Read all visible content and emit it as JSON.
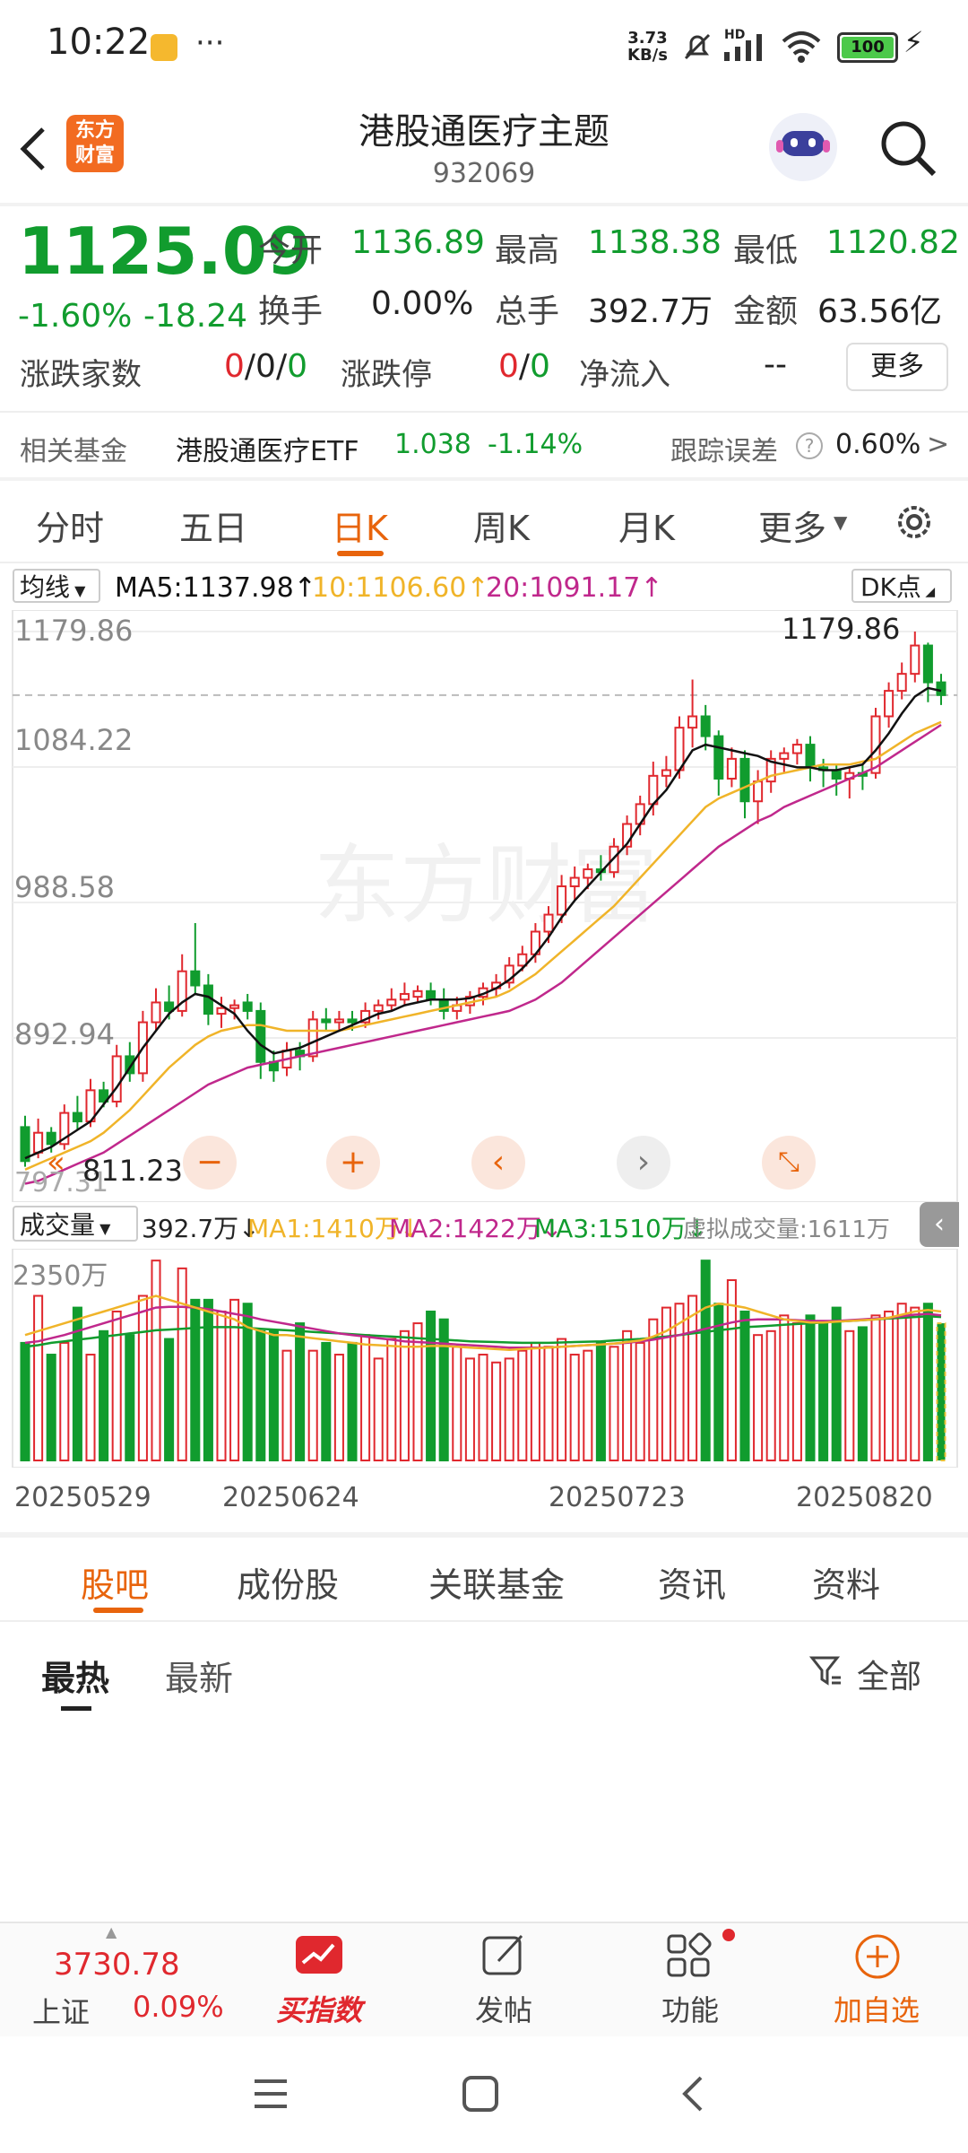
{
  "status_bar": {
    "time": "10:22",
    "more": "···",
    "net_speed_value": "3.73",
    "net_speed_unit": "KB/s",
    "hd": "HD",
    "battery": "100"
  },
  "header": {
    "brand_line1": "东方",
    "brand_line2": "财富",
    "title": "港股通医疗主题",
    "code": "932069"
  },
  "quote": {
    "price": "1125.09",
    "change_pct": "-1.60%",
    "change": "-18.24",
    "open_label": "今开",
    "open": "1136.89",
    "high_label": "最高",
    "high": "1138.38",
    "low_label": "最低",
    "low": "1120.82",
    "turnover_label": "换手",
    "turnover": "0.00%",
    "volume_label": "总手",
    "volume": "392.7万",
    "amount_label": "金额",
    "amount": "63.56亿",
    "breadth_label": "涨跌家数",
    "breadth_1": "0",
    "breadth_sep1": "/",
    "breadth_2": "0",
    "breadth_sep2": "/",
    "breadth_3": "0",
    "limit_label": "涨跌停",
    "limit_1": "0",
    "limit_sep": "/",
    "limit_2": "0",
    "netflow_label": "净流入",
    "netflow": "--",
    "more_button": "更多"
  },
  "fund": {
    "label": "相关基金",
    "name": "港股通医疗ETF",
    "price": "1.038",
    "change": "-1.14%",
    "tracking_label": "跟踪误差",
    "tracking_value": "0.60%",
    "chevron": ">"
  },
  "period_tabs": [
    "分时",
    "五日",
    "日K",
    "周K",
    "月K",
    "更多"
  ],
  "ma_bar": {
    "selector": "均线",
    "ma5": "MA5:1137.98↑",
    "ma10": "10:1106.60↑",
    "ma20": "20:1091.17↑",
    "dk_button": "DK点"
  },
  "kline": {
    "y_labels": [
      "1179.86",
      "1084.22",
      "988.58",
      "892.94",
      "797.31"
    ],
    "max_label": "1179.86",
    "min_label": "811.23",
    "watermark": "东方财富"
  },
  "volume_bar": {
    "selector": "成交量",
    "vol": "392.7万↓",
    "ma1": "MA1:1410万↓",
    "ma2": "MA2:1422万↓",
    "ma3": "MA3:1510万↓",
    "virtual": "虚拟成交量:1611万",
    "y_label": "2350万"
  },
  "x_labels": [
    "20250529",
    "20250624",
    "20250723",
    "20250820"
  ],
  "content_tabs": [
    "股吧",
    "成份股",
    "关联基金",
    "资讯",
    "资料"
  ],
  "sub_tabs": [
    "最热",
    "最新"
  ],
  "filter_label": "全部",
  "bottom_nav": {
    "index_value": "3730.78",
    "index_name": "上证",
    "index_change": "0.09%",
    "buy_label": "买指数",
    "post_label": "发帖",
    "func_label": "功能",
    "add_label": "加自选"
  },
  "colors": {
    "up_red": "#e0282e",
    "down_green": "#119c2e",
    "accent_orange": "#e8640c",
    "ma5_black": "#111111",
    "ma10_yellow": "#f0b429",
    "ma20_magenta": "#c0288c"
  },
  "chart_data": {
    "type": "candlestick",
    "y_range": [
      797.31,
      1179.86
    ],
    "max_marker": 1179.86,
    "min_marker": 811.23,
    "candles": [
      [
        830,
        806,
        838,
        802
      ],
      [
        812,
        826,
        836,
        808
      ],
      [
        826,
        818,
        830,
        812
      ],
      [
        818,
        840,
        846,
        814
      ],
      [
        840,
        834,
        852,
        828
      ],
      [
        834,
        856,
        864,
        830
      ],
      [
        856,
        848,
        862,
        844
      ],
      [
        848,
        880,
        888,
        844
      ],
      [
        880,
        868,
        890,
        862
      ],
      [
        868,
        904,
        912,
        862
      ],
      [
        904,
        918,
        928,
        898
      ],
      [
        918,
        912,
        930,
        906
      ],
      [
        912,
        940,
        952,
        908
      ],
      [
        940,
        930,
        974,
        924
      ],
      [
        930,
        910,
        938,
        902
      ],
      [
        910,
        914,
        922,
        900
      ],
      [
        914,
        916,
        920,
        906
      ],
      [
        918,
        912,
        924,
        906
      ],
      [
        912,
        876,
        918,
        864
      ],
      [
        876,
        870,
        884,
        862
      ],
      [
        872,
        884,
        890,
        866
      ],
      [
        884,
        880,
        890,
        870
      ],
      [
        880,
        906,
        912,
        876
      ],
      [
        906,
        904,
        914,
        898
      ],
      [
        904,
        906,
        912,
        898
      ],
      [
        906,
        904,
        912,
        898
      ],
      [
        904,
        912,
        918,
        900
      ],
      [
        912,
        916,
        920,
        906
      ],
      [
        916,
        920,
        928,
        912
      ],
      [
        920,
        924,
        932,
        916
      ],
      [
        922,
        926,
        930,
        918
      ],
      [
        926,
        920,
        932,
        916
      ],
      [
        920,
        912,
        928,
        906
      ],
      [
        912,
        916,
        922,
        906
      ],
      [
        916,
        922,
        926,
        910
      ],
      [
        922,
        928,
        932,
        916
      ],
      [
        928,
        932,
        938,
        922
      ],
      [
        932,
        944,
        950,
        928
      ],
      [
        944,
        952,
        958,
        940
      ],
      [
        952,
        968,
        974,
        946
      ],
      [
        968,
        980,
        986,
        960
      ],
      [
        980,
        1000,
        1008,
        974
      ],
      [
        1000,
        1006,
        1014,
        990
      ],
      [
        1006,
        1012,
        1016,
        998
      ],
      [
        1012,
        1010,
        1022,
        1004
      ],
      [
        1010,
        1028,
        1034,
        1006
      ],
      [
        1028,
        1044,
        1050,
        1022
      ],
      [
        1044,
        1058,
        1064,
        1036
      ],
      [
        1058,
        1078,
        1088,
        1050
      ],
      [
        1078,
        1082,
        1092,
        1070
      ],
      [
        1082,
        1112,
        1120,
        1076
      ],
      [
        1112,
        1120,
        1146,
        1098
      ],
      [
        1120,
        1106,
        1128,
        1096
      ],
      [
        1106,
        1076,
        1110,
        1064
      ],
      [
        1076,
        1090,
        1098,
        1070
      ],
      [
        1090,
        1060,
        1096,
        1048
      ],
      [
        1060,
        1074,
        1082,
        1044
      ],
      [
        1074,
        1090,
        1096,
        1066
      ],
      [
        1090,
        1094,
        1098,
        1080
      ],
      [
        1094,
        1100,
        1104,
        1086
      ],
      [
        1100,
        1084,
        1106,
        1074
      ],
      [
        1084,
        1082,
        1090,
        1070
      ],
      [
        1082,
        1076,
        1086,
        1064
      ],
      [
        1076,
        1080,
        1084,
        1062
      ],
      [
        1080,
        1078,
        1086,
        1068
      ],
      [
        1080,
        1120,
        1126,
        1076
      ],
      [
        1120,
        1138,
        1144,
        1112
      ],
      [
        1138,
        1150,
        1158,
        1132
      ],
      [
        1150,
        1170,
        1179.86,
        1144
      ],
      [
        1170,
        1144,
        1172,
        1130
      ],
      [
        1144,
        1135,
        1150,
        1128
      ]
    ],
    "ma5": [
      808,
      812,
      816,
      822,
      828,
      834,
      846,
      858,
      872,
      886,
      898,
      910,
      918,
      924,
      922,
      916,
      910,
      898,
      888,
      882,
      884,
      886,
      890,
      894,
      898,
      902,
      906,
      910,
      912,
      916,
      918,
      920,
      920,
      920,
      921,
      924,
      928,
      934,
      942,
      952,
      964,
      978,
      990,
      1000,
      1010,
      1020,
      1030,
      1044,
      1058,
      1068,
      1082,
      1096,
      1100,
      1098,
      1096,
      1094,
      1092,
      1088,
      1086,
      1084,
      1084,
      1082,
      1082,
      1084,
      1086,
      1096,
      1108,
      1122,
      1134,
      1140,
      1138
    ],
    "ma10": [
      800,
      804,
      808,
      812,
      816,
      820,
      826,
      834,
      842,
      852,
      862,
      872,
      880,
      888,
      894,
      898,
      900,
      902,
      902,
      900,
      898,
      898,
      898,
      898,
      898,
      900,
      902,
      904,
      906,
      908,
      910,
      912,
      914,
      916,
      918,
      920,
      922,
      926,
      932,
      938,
      946,
      954,
      962,
      970,
      978,
      986,
      996,
      1006,
      1016,
      1026,
      1036,
      1046,
      1056,
      1062,
      1066,
      1070,
      1074,
      1078,
      1080,
      1082,
      1084,
      1086,
      1086,
      1086,
      1088,
      1090,
      1096,
      1102,
      1108,
      1112,
      1116
    ],
    "ma20": [
      790,
      792,
      796,
      800,
      804,
      808,
      812,
      818,
      824,
      830,
      836,
      842,
      848,
      854,
      860,
      864,
      868,
      872,
      874,
      876,
      878,
      880,
      882,
      884,
      886,
      888,
      890,
      892,
      894,
      896,
      898,
      900,
      902,
      904,
      906,
      908,
      910,
      912,
      916,
      920,
      926,
      932,
      940,
      948,
      956,
      964,
      972,
      980,
      988,
      996,
      1004,
      1012,
      1020,
      1028,
      1034,
      1040,
      1046,
      1050,
      1056,
      1060,
      1064,
      1068,
      1072,
      1076,
      1080,
      1084,
      1090,
      1096,
      1102,
      1108,
      1114
    ],
    "volume_max": 2350,
    "volumes": [
      1500,
      2100,
      1350,
      1500,
      1950,
      1350,
      1650,
      1900,
      1600,
      2100,
      2550,
      1550,
      2450,
      2050,
      2050,
      1900,
      2050,
      2000,
      1650,
      1650,
      1400,
      1750,
      1400,
      1500,
      1350,
      1500,
      1600,
      1300,
      1550,
      1650,
      1750,
      1900,
      1800,
      1450,
      1300,
      1350,
      1250,
      1300,
      1400,
      1500,
      1450,
      1550,
      1350,
      1400,
      1500,
      1450,
      1650,
      1500,
      1800,
      1950,
      2000,
      2100,
      2550,
      2000,
      2300,
      1900,
      1600,
      1650,
      1850,
      1750,
      1850,
      1750,
      1950,
      1650,
      1700,
      1850,
      1900,
      2000,
      1950,
      2000,
      1750
    ],
    "vol_ma_yellow": [
      1600,
      1650,
      1700,
      1750,
      1800,
      1850,
      1900,
      1950,
      2000,
      2050,
      2100,
      2050,
      2000,
      1950,
      1900,
      1850,
      1800,
      1700,
      1650,
      1600,
      1600,
      1580,
      1560,
      1540,
      1520,
      1500,
      1480,
      1470,
      1460,
      1450,
      1450,
      1460,
      1460,
      1450,
      1440,
      1430,
      1420,
      1410,
      1420,
      1430,
      1440,
      1450,
      1460,
      1470,
      1480,
      1490,
      1510,
      1530,
      1580,
      1650,
      1750,
      1850,
      1950,
      2000,
      1980,
      1950,
      1900,
      1850,
      1800,
      1780,
      1760,
      1760,
      1770,
      1780,
      1790,
      1800,
      1820,
      1860,
      1900,
      1920,
      1900
    ],
    "vol_ma_magenta": [
      1500,
      1520,
      1560,
      1600,
      1650,
      1700,
      1750,
      1800,
      1850,
      1900,
      1950,
      1960,
      1960,
      1950,
      1930,
      1900,
      1870,
      1840,
      1800,
      1770,
      1740,
      1710,
      1680,
      1650,
      1620,
      1600,
      1580,
      1560,
      1540,
      1520,
      1510,
      1500,
      1490,
      1480,
      1470,
      1460,
      1450,
      1440,
      1440,
      1440,
      1440,
      1450,
      1460,
      1470,
      1480,
      1490,
      1500,
      1520,
      1540,
      1570,
      1600,
      1640,
      1680,
      1720,
      1760,
      1790,
      1800,
      1800,
      1800,
      1790,
      1780,
      1780,
      1780,
      1790,
      1800,
      1810,
      1820,
      1840,
      1860,
      1870,
      1850
    ],
    "vol_ma_green": [
      1450,
      1470,
      1500,
      1520,
      1540,
      1560,
      1580,
      1600,
      1620,
      1640,
      1660,
      1670,
      1680,
      1690,
      1700,
      1700,
      1700,
      1690,
      1680,
      1670,
      1660,
      1650,
      1640,
      1630,
      1620,
      1610,
      1600,
      1590,
      1580,
      1570,
      1560,
      1550,
      1540,
      1530,
      1520,
      1515,
      1510,
      1505,
      1500,
      1500,
      1500,
      1505,
      1510,
      1515,
      1520,
      1530,
      1540,
      1550,
      1565,
      1580,
      1600,
      1620,
      1640,
      1660,
      1680,
      1700,
      1710,
      1720,
      1730,
      1740,
      1750,
      1760,
      1770,
      1780,
      1790,
      1800,
      1810,
      1820,
      1830,
      1840,
      1830
    ]
  }
}
